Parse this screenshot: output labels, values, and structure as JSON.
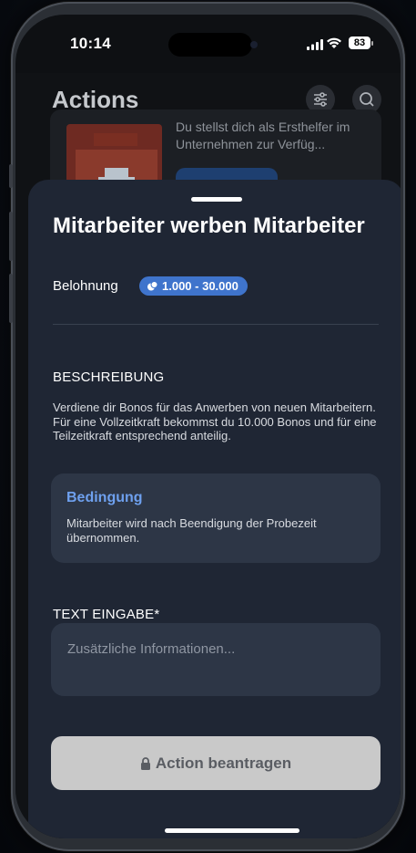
{
  "status_bar": {
    "time": "10:14",
    "battery": "83"
  },
  "header": {
    "title": "Actions"
  },
  "background_card": {
    "description": "Du stellst dich als Ersthelfer im Unternehmen zur Verfüg..."
  },
  "sheet": {
    "title": "Mitarbeiter werben Mitarbeiter",
    "reward_label": "Belohnung",
    "reward_range": "1.000 - 30.000",
    "description_heading": "BESCHREIBUNG",
    "description_lines": [
      "Verdiene dir Bonos für das Anwerben von neuen Mitarbeitern.",
      "Für eine Vollzeitkraft bekommst du 10.000 Bonos und für eine Teilzeitkraft entsprechend anteilig."
    ],
    "condition": {
      "title": "Bedingung",
      "text": "Mitarbeiter wird nach Beendigung der Probezeit übernommen."
    },
    "text_input_heading": "TEXT EINGABE*",
    "text_input_placeholder": "Zusätzliche Informationen...",
    "submit_label": "Action beantragen"
  },
  "colors": {
    "sheet_bg": "#1f2634",
    "card_bg": "#2d3646",
    "accent_blue": "#3f74cc",
    "condition_title": "#6ea0ee",
    "button_disabled": "#c9c9c9"
  },
  "icons": [
    "filter-icon",
    "search-icon",
    "coin-icon",
    "lock-icon",
    "signal-icon",
    "wifi-icon",
    "battery-icon"
  ]
}
